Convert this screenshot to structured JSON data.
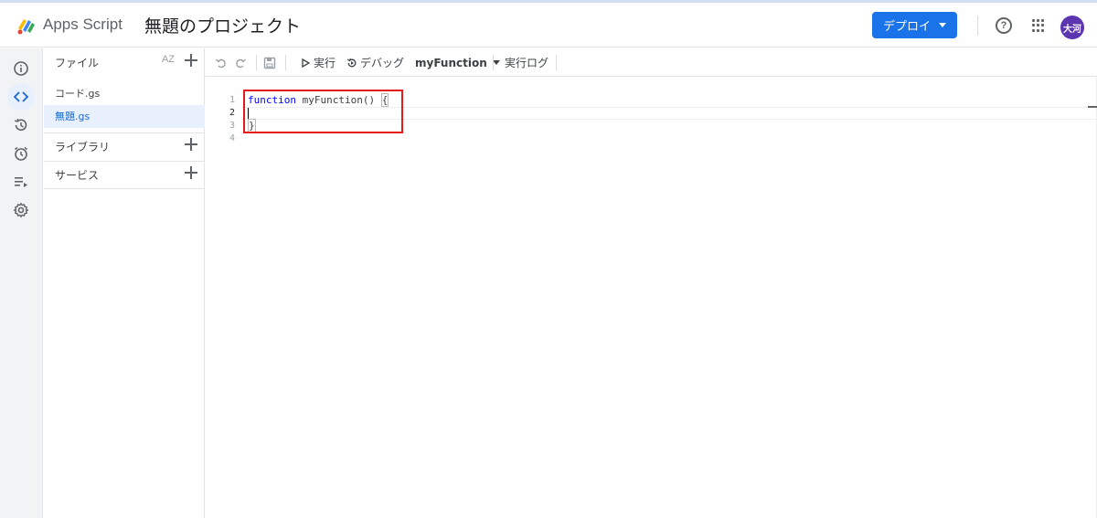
{
  "header": {
    "app_name": "Apps Script",
    "project_title": "無題のプロジェクト",
    "deploy_label": "デプロイ",
    "help_symbol": "?",
    "avatar_initials": "大河",
    "colors": {
      "deploy": "#1a73e8",
      "avatar": "#5e35b1"
    }
  },
  "rail": {
    "items": [
      {
        "icon": "info-icon"
      },
      {
        "icon": "code-icon",
        "active": true
      },
      {
        "icon": "history-icon"
      },
      {
        "icon": "alarm-icon"
      },
      {
        "icon": "executions-icon"
      },
      {
        "icon": "gear-icon"
      }
    ]
  },
  "files": {
    "header_label": "ファイル",
    "sort_label": "AZ",
    "items": [
      {
        "name": "コード.gs",
        "selected": false
      },
      {
        "name": "無題.gs",
        "selected": true
      }
    ],
    "libraries_label": "ライブラリ",
    "services_label": "サービス"
  },
  "toolbar": {
    "run_label": "実行",
    "debug_label": "デバッグ",
    "function_name": "myFunction",
    "log_label": "実行ログ"
  },
  "editor": {
    "line_numbers": [
      "1",
      "2",
      "3",
      "4"
    ],
    "current_line": 2,
    "code": {
      "line1_keyword": "function",
      "line1_rest": " myFunction() ",
      "line1_brace": "{",
      "line3_brace": "}"
    },
    "highlight_color": "#e31b1b"
  }
}
